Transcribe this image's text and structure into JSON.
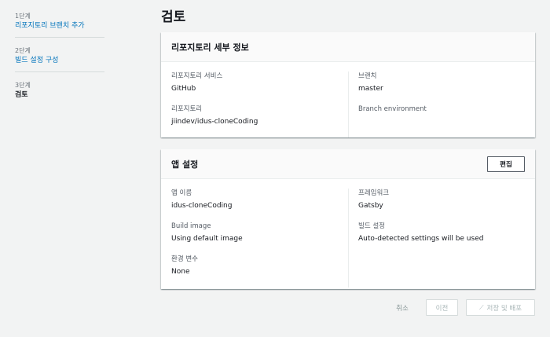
{
  "sidebar": {
    "steps": [
      {
        "number": "1단계",
        "label": "리포지토리 브랜치 추가"
      },
      {
        "number": "2단계",
        "label": "빌드 설정 구성"
      },
      {
        "number": "3단계",
        "label": "검토"
      }
    ]
  },
  "page": {
    "title": "검토"
  },
  "repo_panel": {
    "title": "리포지토리 세부 정보",
    "fields": {
      "service_label": "리포지토리 서비스",
      "service_value": "GitHub",
      "repo_label": "리포지토리",
      "repo_value": "jiindev/idus-cloneCoding",
      "branch_label": "브랜치",
      "branch_value": "master",
      "branch_env_label": "Branch environment"
    }
  },
  "app_panel": {
    "title": "앱 설정",
    "edit_label": "편집",
    "fields": {
      "app_name_label": "앱 이름",
      "app_name_value": "idus-cloneCoding",
      "build_image_label": "Build image",
      "build_image_value": "Using default image",
      "env_label": "환경 변수",
      "env_value": "None",
      "framework_label": "프레임워크",
      "framework_value": "Gatsby",
      "build_settings_label": "빌드 설정",
      "build_settings_value": "Auto-detected settings will be used"
    }
  },
  "actions": {
    "cancel_label": "취소",
    "prev_label": "이전",
    "save_label": "저장 및 배포",
    "save_icon": "spinner-icon"
  },
  "colors": {
    "link": "#0073bb",
    "background": "#f2f3f3",
    "disabled_text": "#aab7b8"
  }
}
